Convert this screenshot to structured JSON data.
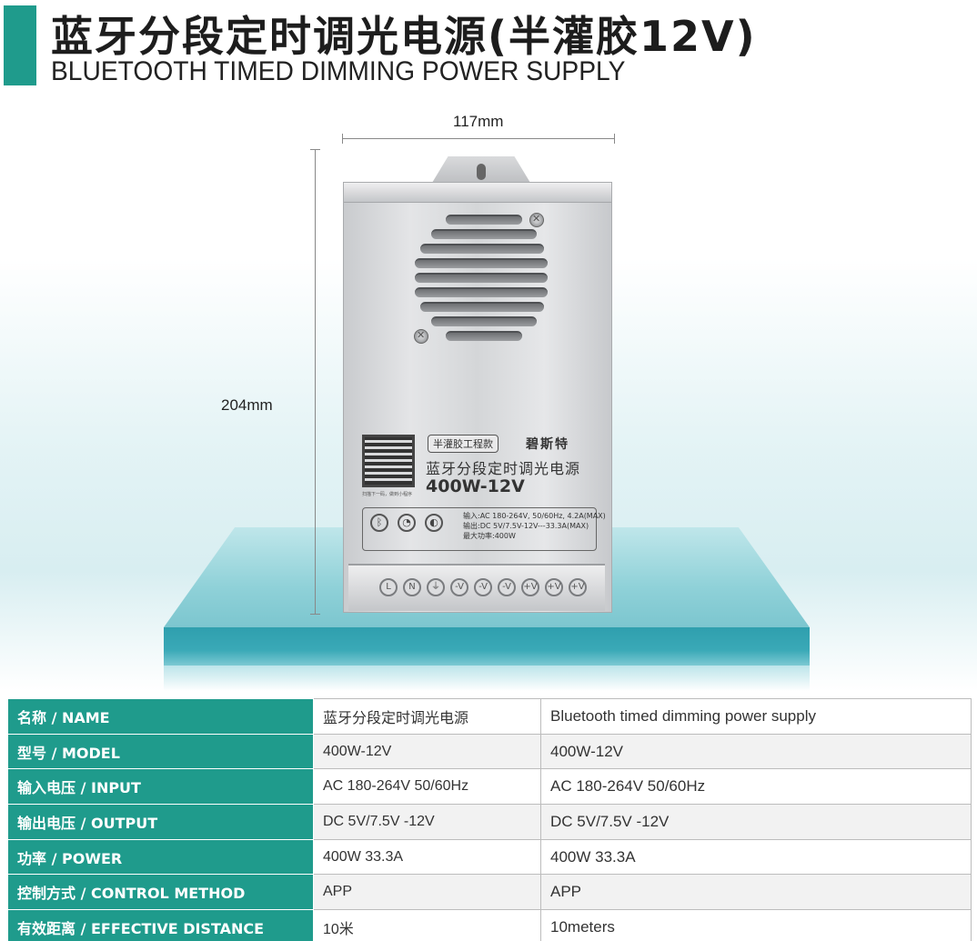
{
  "header": {
    "title_cn": "蓝牙分段定时调光电源(半灌胶12V)",
    "title_en": "BLUETOOTH TIMED DIMMING POWER SUPPLY"
  },
  "dimensions": {
    "width_label": "117mm",
    "height_label": "204mm"
  },
  "device_label": {
    "badge": "半灌胶工程款",
    "brand": "碧斯特",
    "name": "蓝牙分段定时调光电源",
    "model": "400W-12V",
    "qr_caption": "扫描下一码，做到小程序",
    "spec_lines": [
      "输入:AC 180-264V, 50/60Hz, 4.2A(MAX)",
      "输出:DC 5V/7.5V-12V---33.3A(MAX)",
      "最大功率:400W"
    ],
    "terminals": [
      "L",
      "N",
      "⏚",
      "-V",
      "-V",
      "-V",
      "+V",
      "+V",
      "+V"
    ]
  },
  "spec_table": {
    "rows": [
      {
        "key": "名称 / NAME",
        "cn": "蓝牙分段定时调光电源",
        "en": "Bluetooth timed dimming power supply"
      },
      {
        "key": "型号 / MODEL",
        "cn": "400W-12V",
        "en": "400W-12V"
      },
      {
        "key": "输入电压 / INPUT",
        "cn": "AC  180-264V  50/60Hz",
        "en": "AC  180-264V  50/60Hz"
      },
      {
        "key": "输出电压 / OUTPUT",
        "cn": "DC  5V/7.5V -12V",
        "en": "DC  5V/7.5V -12V"
      },
      {
        "key": "功率 / POWER",
        "cn": "400W    33.3A",
        "en": "400W   33.3A"
      },
      {
        "key": "控制方式 / CONTROL METHOD",
        "cn": "APP",
        "en": "APP"
      },
      {
        "key": "有效距离 / EFFECTIVE DISTANCE",
        "cn": "10米",
        "en": "10meters"
      }
    ]
  },
  "colors": {
    "accent": "#1f9b8c",
    "platform": "#3aa9b7"
  }
}
